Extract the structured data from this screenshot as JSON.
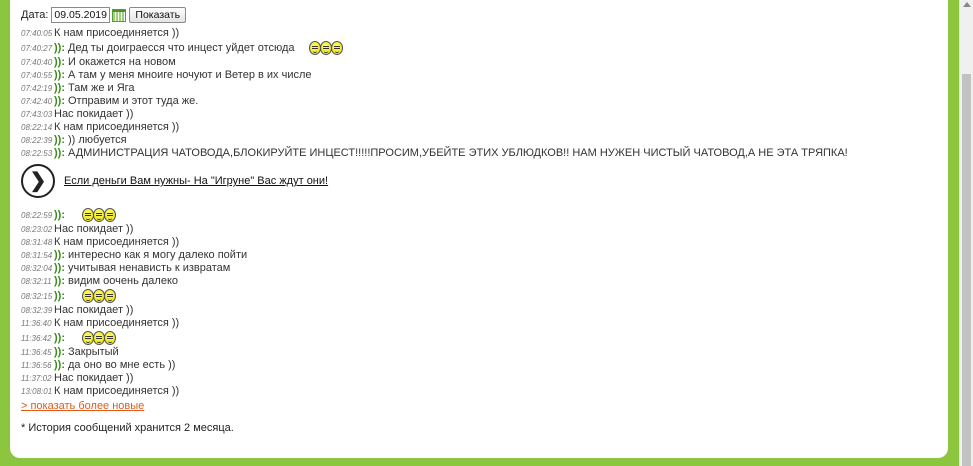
{
  "datebar": {
    "label": "Дата:",
    "date_value": "09.05.2019",
    "show_button": "Показать"
  },
  "messages": [
    {
      "time": "07:40:05",
      "nick": "",
      "text": "К нам присоединяется ))",
      "smilies": 0
    },
    {
      "time": "07:40:27",
      "nick": ")):",
      "text": "Дед ты доиграесся что инцест уйдет отсюда",
      "smilies": 3
    },
    {
      "time": "07:40:40",
      "nick": ")):",
      "text": "И окажется на новом",
      "smilies": 0
    },
    {
      "time": "07:40:55",
      "nick": ")):",
      "text": "А там у меня мноиге ночуют и Ветер в их числе",
      "smilies": 0
    },
    {
      "time": "07:42:19",
      "nick": ")):",
      "text": "Там же и Яга",
      "smilies": 0
    },
    {
      "time": "07:42:40",
      "nick": ")):",
      "text": "Отправим и этот туда же.",
      "smilies": 0
    },
    {
      "time": "07:43:03",
      "nick": "",
      "text": "Нас покидает ))",
      "smilies": 0
    },
    {
      "time": "08:22:14",
      "nick": "",
      "text": "К нам присоединяется ))",
      "smilies": 0
    },
    {
      "time": "08:22:39",
      "nick": ")):",
      "text": ")) любуется",
      "smilies": 0
    },
    {
      "time": "08:22:53",
      "nick": ")):",
      "text": "АДМИНИСТРАЦИЯ ЧАТОВОДА,БЛОКИРУЙТЕ ИНЦЕСТ!!!!!ПРОСИМ,УБЕЙТЕ ЭТИХ УБЛЮДКОВ!! НАМ НУЖЕН ЧИСТЫЙ ЧАТОВОД,А НЕ ЭТА ТРЯПКА!",
      "smilies": 0
    }
  ],
  "ad": {
    "arrow": "❯",
    "text": "Если деньги Вам нужны- На \"Игруне\" Вас ждут они!"
  },
  "messages2": [
    {
      "time": "08:22:59",
      "nick": ")):",
      "text": "",
      "smilies": 3
    },
    {
      "time": "08:23:02",
      "nick": "",
      "text": "Нас покидает ))",
      "smilies": 0
    },
    {
      "time": "08:31:48",
      "nick": "",
      "text": "К нам присоединяется ))",
      "smilies": 0
    },
    {
      "time": "08:31:54",
      "nick": ")):",
      "text": "интересно как я могу далеко пойти",
      "smilies": 0
    },
    {
      "time": "08:32:04",
      "nick": ")):",
      "text": "учитывая ненависть к извратам",
      "smilies": 0
    },
    {
      "time": "08:32:11",
      "nick": ")):",
      "text": "видим оочень далеко",
      "smilies": 0
    },
    {
      "time": "08:32:15",
      "nick": ")):",
      "text": "",
      "smilies": 3
    },
    {
      "time": "08:32:39",
      "nick": "",
      "text": "Нас покидает ))",
      "smilies": 0
    },
    {
      "time": "11:36:40",
      "nick": "",
      "text": "К нам присоединяется ))",
      "smilies": 0
    },
    {
      "time": "11:36:42",
      "nick": ")):",
      "text": "",
      "smilies": 3
    },
    {
      "time": "11:36:45",
      "nick": ")):",
      "text": "Закрытый",
      "smilies": 0
    },
    {
      "time": "11:36:56",
      "nick": ")):",
      "text": "да оно во мне есть ))",
      "smilies": 0
    },
    {
      "time": "11:37:02",
      "nick": "",
      "text": "Нас покидает ))",
      "smilies": 0
    },
    {
      "time": "13:08:01",
      "nick": "",
      "text": "К нам присоединяется ))",
      "smilies": 0
    }
  ],
  "more_link": "> показать более новые",
  "note": "* История сообщений хранится 2 месяца.",
  "icons": {
    "calendar": "calendar-icon",
    "smiley": "smiley-icon",
    "arrow": "arrow-right-circle-icon"
  },
  "colors": {
    "background": "#8cc63f",
    "nick": "#3a8a1a",
    "link": "#e05a1a"
  }
}
